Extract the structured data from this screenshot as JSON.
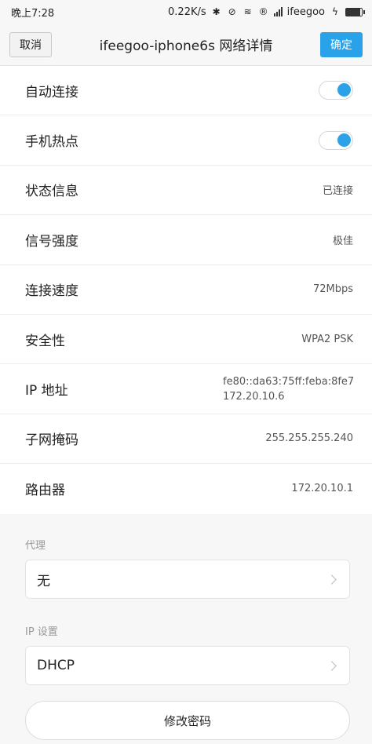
{
  "status_bar": {
    "time": "晚上7:28",
    "speed": "0.22K/s",
    "carrier": "ifeegoo",
    "icons": [
      "bluetooth-icon",
      "no-disturb-icon",
      "wifi-icon",
      "r-icon",
      "signal-icon",
      "battery-icon",
      "charging-icon"
    ],
    "battery_level": 0.9
  },
  "title_bar": {
    "cancel": "取消",
    "title": "ifeegoo-iphone6s  网络详情",
    "confirm": "确定"
  },
  "rows": [
    {
      "label": "自动连接",
      "toggle": true
    },
    {
      "label": "手机热点",
      "toggle": true
    },
    {
      "label": "状态信息",
      "value": "已连接"
    },
    {
      "label": "信号强度",
      "value": "极佳"
    },
    {
      "label": "连接速度",
      "value": "72Mbps"
    },
    {
      "label": "安全性",
      "value": "WPA2 PSK"
    },
    {
      "label": "IP 地址",
      "value_lines": [
        "fe80::da63:75ff:feba:8fe7",
        "172.20.10.6"
      ]
    },
    {
      "label": "子网掩码",
      "value": "255.255.255.240"
    },
    {
      "label": "路由器",
      "value": "172.20.10.1"
    }
  ],
  "proxy": {
    "label": "代理",
    "value": "无"
  },
  "ip_settings": {
    "label": "IP 设置",
    "value": "DHCP"
  },
  "change_password": "修改密码",
  "colors": {
    "accent": "#2aa2ea",
    "background": "#f7f7f7",
    "card": "#ffffff"
  }
}
